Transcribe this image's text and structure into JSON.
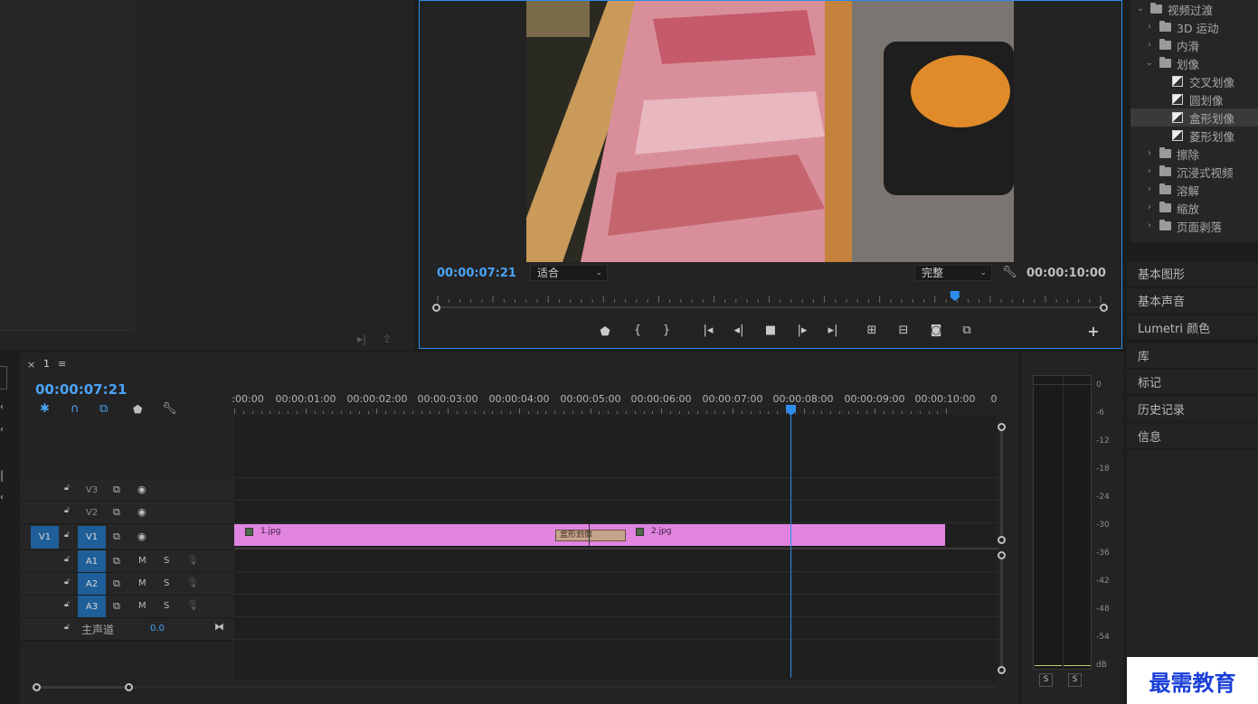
{
  "program": {
    "current_time": "00:00:07:21",
    "zoom": "适合",
    "quality": "完整",
    "duration": "00:00:10:00",
    "playhead_fraction": 0.78
  },
  "effects": {
    "root": "视频过渡",
    "items": [
      {
        "label": "3D 运动",
        "type": "folder",
        "open": false
      },
      {
        "label": "内滑",
        "type": "folder",
        "open": false
      },
      {
        "label": "划像",
        "type": "folder",
        "open": true
      },
      {
        "label": "交叉划像",
        "type": "fx"
      },
      {
        "label": "圆划像",
        "type": "fx"
      },
      {
        "label": "盒形划像",
        "type": "fx",
        "selected": true
      },
      {
        "label": "菱形划像",
        "type": "fx"
      },
      {
        "label": "擦除",
        "type": "folder",
        "open": false
      },
      {
        "label": "沉浸式视频",
        "type": "folder",
        "open": false
      },
      {
        "label": "溶解",
        "type": "folder",
        "open": false
      },
      {
        "label": "缩放",
        "type": "folder",
        "open": false
      },
      {
        "label": "页面剥落",
        "type": "folder",
        "open": false
      }
    ]
  },
  "right_panels": [
    "基本图形",
    "基本声音",
    "Lumetri 颜色",
    "库",
    "标记",
    "历史记录",
    "信息"
  ],
  "timeline": {
    "tab_close": "×",
    "tab_name": "1",
    "timecode": "00:00:07:21",
    "ruler_labels": [
      ":00:00",
      "00:00:01:00",
      "00:00:02:00",
      "00:00:03:00",
      "00:00:04:00",
      "00:00:05:00",
      "00:00:06:00",
      "00:00:07:00",
      "00:00:08:00",
      "00:00:09:00",
      "00:00:10:00",
      "0"
    ],
    "video_tracks": [
      {
        "name": "V3",
        "src": ""
      },
      {
        "name": "V2",
        "src": ""
      },
      {
        "name": "V1",
        "src": "V1"
      }
    ],
    "audio_tracks": [
      {
        "name": "A1",
        "m": "M",
        "s": "S"
      },
      {
        "name": "A2",
        "m": "M",
        "s": "S"
      },
      {
        "name": "A3",
        "m": "M",
        "s": "S"
      }
    ],
    "master": {
      "label": "主声道",
      "value": "0.0"
    },
    "clips": [
      {
        "label": "1.jpg"
      },
      {
        "label": "2.jpg"
      }
    ],
    "transition_label": "盒形划像",
    "clip_color": "#e084e0"
  },
  "meter": {
    "labels": [
      "0",
      "-6",
      "-12",
      "-18",
      "-24",
      "-30",
      "-36",
      "-42",
      "-48",
      "-54",
      "dB"
    ],
    "solo_left": "S",
    "solo_right": "S"
  },
  "watermark": "最需教育"
}
